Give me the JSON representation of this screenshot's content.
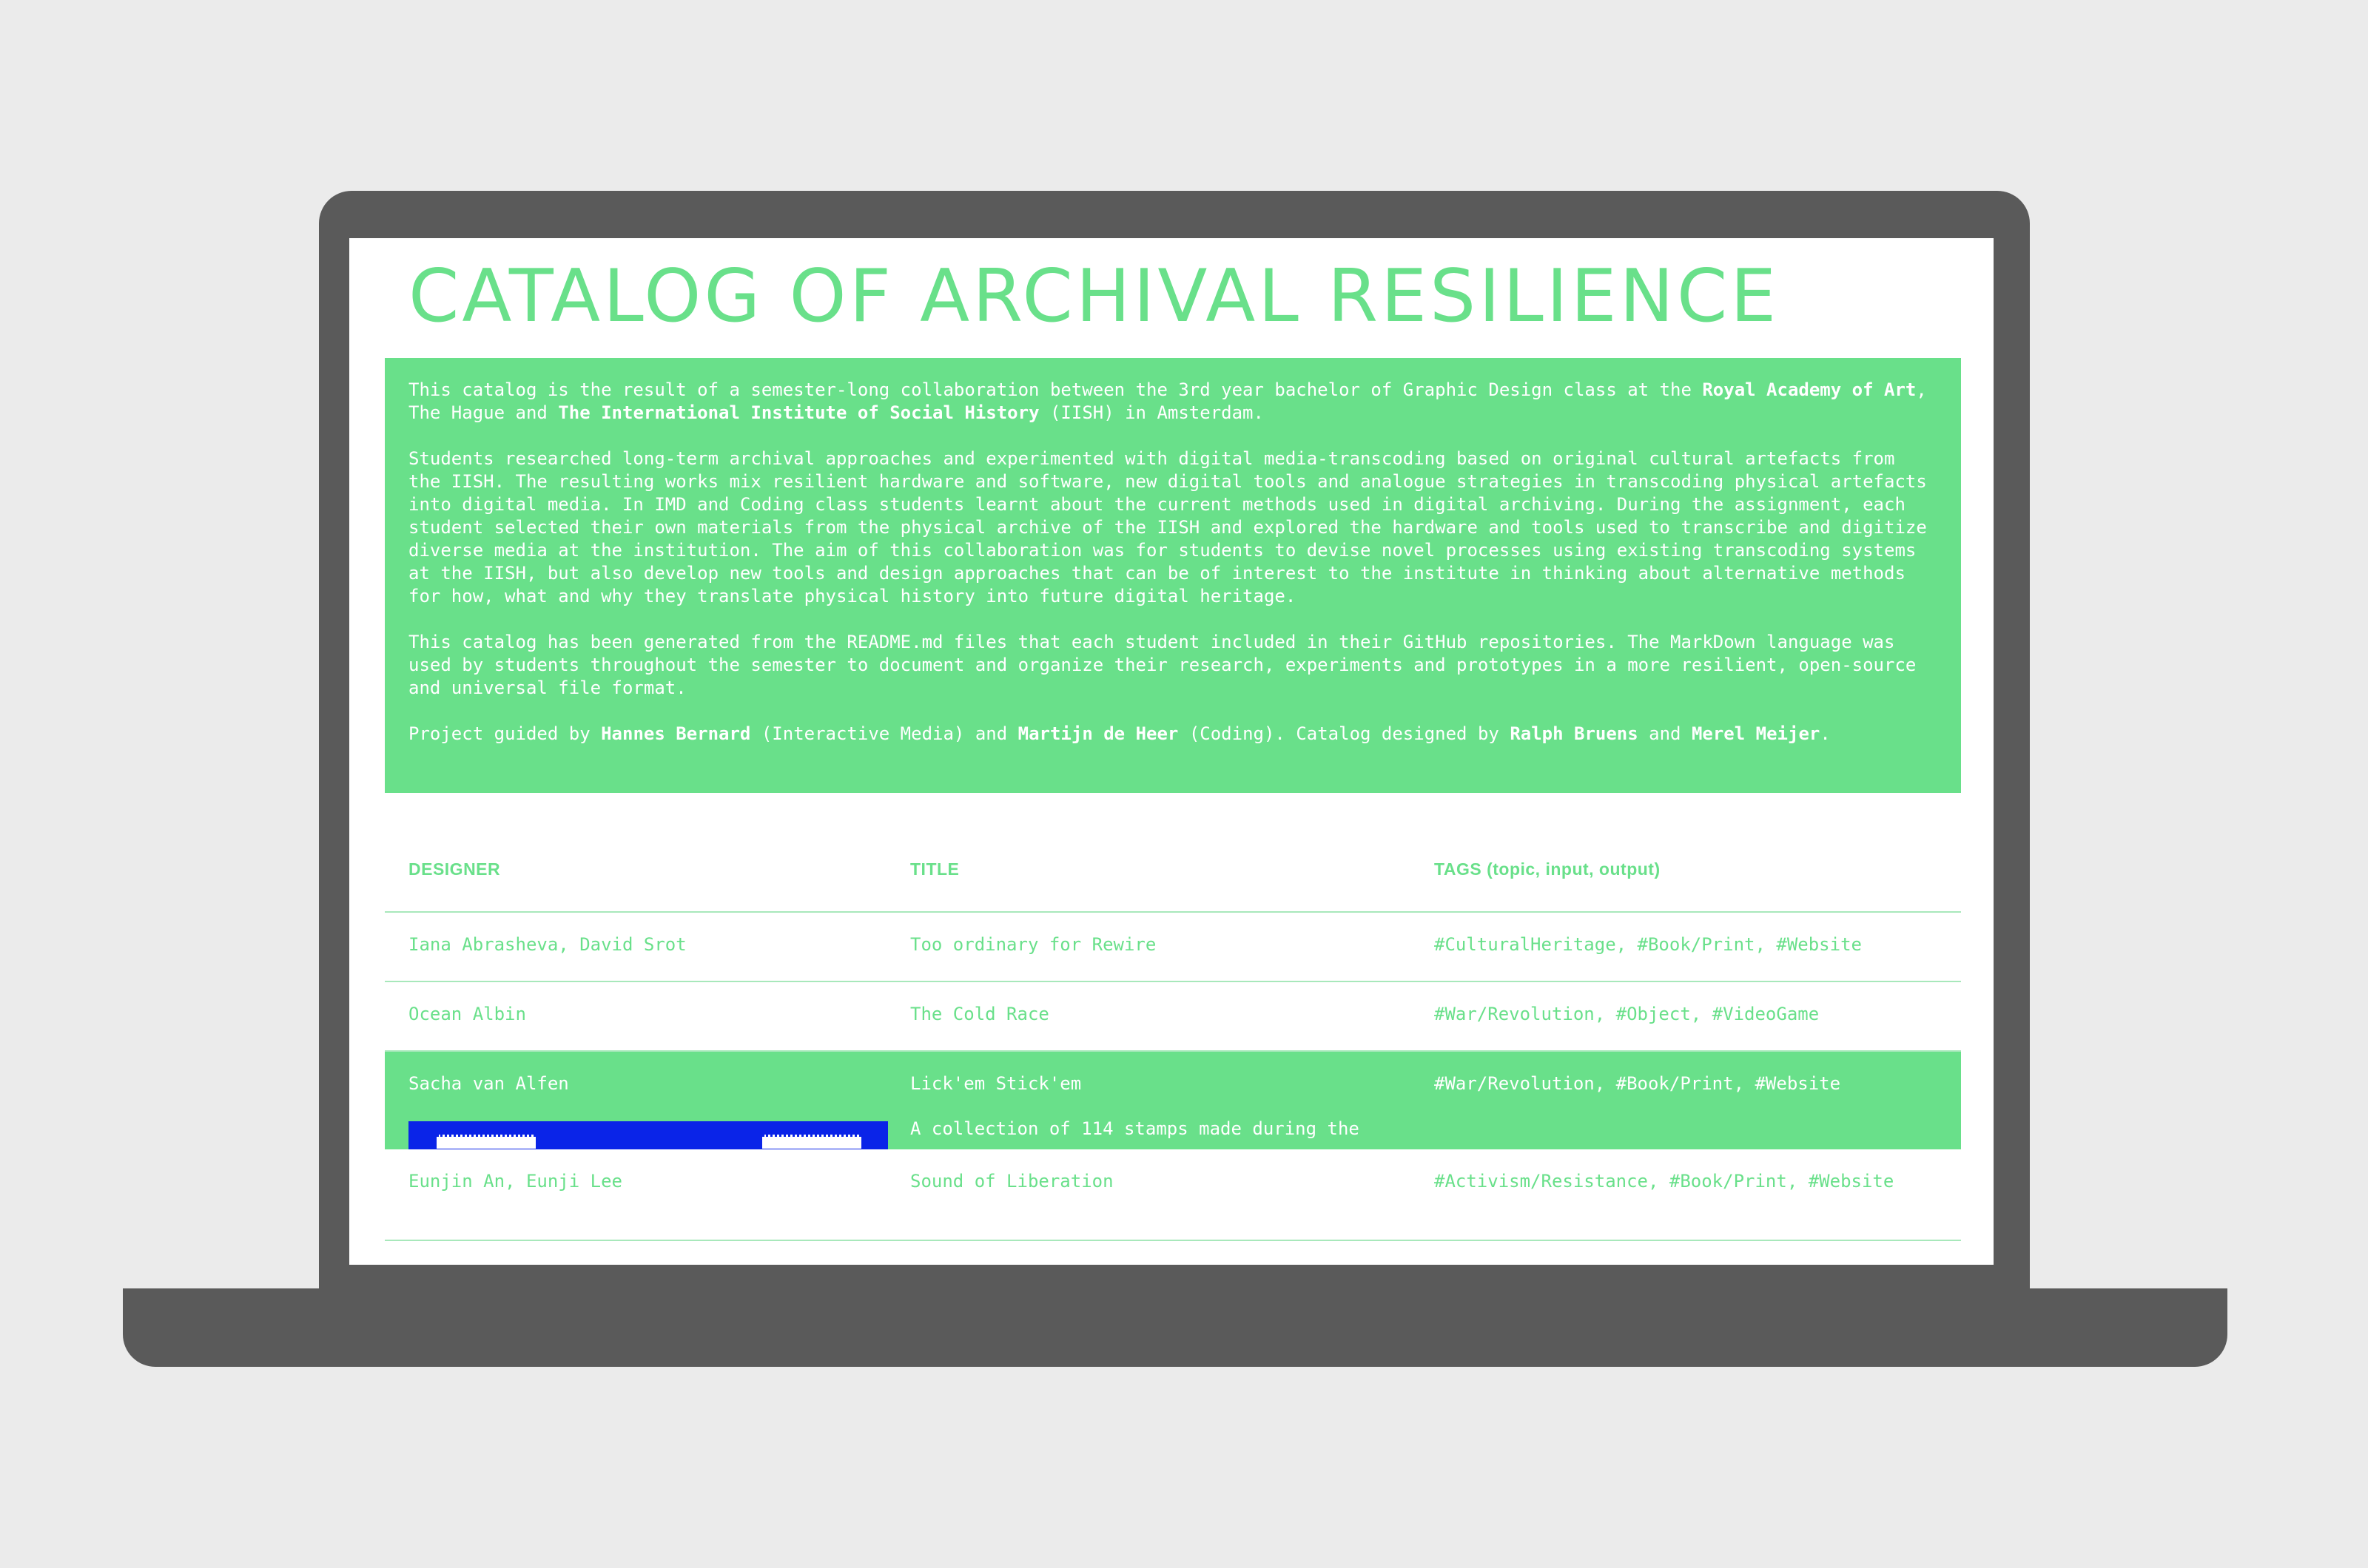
{
  "catalog": {
    "title": "CATALOG OF ARCHIVAL RESILIENCE",
    "intro": {
      "p1": {
        "a": "This catalog is the result of a semester-long collaboration between the 3rd year bachelor of Graphic Design class at the ",
        "b": "Royal Academy of Art",
        "c": ", The Hague and ",
        "d": "The International Institute of Social History",
        "e": " (IISH) in Amsterdam."
      },
      "p2": "Students researched long-term archival approaches and experimented with digital media-transcoding based on original cultural artefacts from the IISH. The resulting works mix resilient hardware and software, new digital tools and analogue strategies in transcoding physical artefacts into digital media. In IMD and Coding class students learnt about the current methods used in digital archiving. During the assignment, each student selected their own materials from the physical archive of the IISH and explored the hardware and tools used to transcribe and digitize diverse media at the institution. The aim of this collaboration was for students to devise novel processes using existing transcoding systems at the IISH, but also develop new tools and design approaches that can be of interest to the institute in thinking about alternative methods for how, what and why they translate physical history into future digital heritage.",
      "p3": "This catalog has been generated from the README.md files that each student included in their GitHub repositories. The MarkDown language was used by students throughout the semester to document and organize their research, experiments and prototypes in a more resilient, open-source and universal file format.",
      "p4": {
        "a": "Project guided by ",
        "b": "Hannes Bernard",
        "c": " (Interactive Media) and ",
        "d": "Martijn de Heer",
        "e": " (Coding). Catalog designed by ",
        "f": "Ralph Bruens",
        "g": " and ",
        "h": "Merel Meijer",
        "i": "."
      }
    },
    "table": {
      "headers": {
        "designer": "DESIGNER",
        "title": "TITLE",
        "tags": "TAGS (topic, input, output)"
      },
      "rows": [
        {
          "designer": "Iana Abrasheva, David Srot",
          "title": "Too ordinary for Rewire",
          "tags": "#CulturalHeritage, #Book/Print, #Website"
        },
        {
          "designer": "Ocean Albin",
          "title": "The Cold Race",
          "tags": "#War/Revolution, #Object, #VideoGame"
        },
        {
          "designer": "Sacha van Alfen",
          "title": "Lick'em Stick'em",
          "tags": "#War/Revolution, #Book/Print, #Website",
          "description": "A collection of 114 stamps made during the"
        },
        {
          "designer": "Eunjin An, Eunji Lee",
          "title": "Sound of Liberation",
          "tags": "#Activism/Resistance, #Book/Print, #Website"
        }
      ]
    },
    "colors": {
      "accent": "#69e08a",
      "preview_blue": "#0a24e8",
      "device_gray": "#5a5a5a",
      "backdrop": "#ebebeb"
    }
  }
}
